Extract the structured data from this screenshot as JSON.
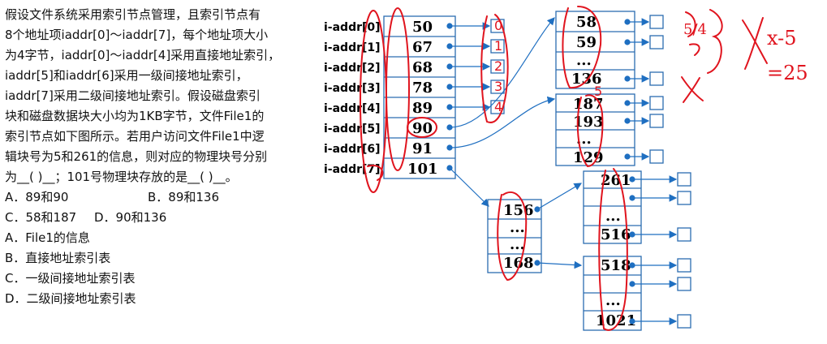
{
  "question": {
    "lines": [
      "假设文件系统采用索引节点管理，且索引节点有",
      "8个地址项iaddr[0]～iaddr[7]，每个地址项大小",
      "为4字节，iaddr[0]～iaddr[4]采用直接地址索引，",
      "iaddr[5]和iaddr[6]采用一级间接地址索引，",
      "iaddr[7]采用二级间接地址索引。假设磁盘索引",
      "块和磁盘数据块大小均为1KB字节，文件File1的",
      "索引节点如下图所示。若用户访问文件File1中逻",
      "辑块号为5和261的信息，则对应的物理块号分别",
      "为__( )__；101号物理块存放的是__( )__。"
    ],
    "options_row1": [
      {
        "label": "A．89和90",
        "right": "B．89和136"
      }
    ],
    "options_row2": [
      {
        "label": "C．58和187",
        "right": "D．90和136"
      }
    ],
    "options_single": [
      "A．File1的信息",
      "B．直接地址索引表",
      "C．一级间接地址索引表",
      "D．二级间接地址索引表"
    ]
  },
  "diagram": {
    "iaddr_labels": [
      "i-addr[0]",
      "i-addr[1]",
      "i-addr[2]",
      "i-addr[3]",
      "i-addr[4]",
      "i-addr[5]",
      "i-addr[6]",
      "i-addr[7]"
    ],
    "iaddr_values": [
      "50",
      "67",
      "68",
      "78",
      "89",
      "90",
      "91",
      "101"
    ],
    "block_a": [
      "58",
      "59",
      "...",
      "136"
    ],
    "block_b": [
      "187",
      "193",
      "...",
      "129"
    ],
    "block_c": [
      "156",
      "...",
      "...",
      "168"
    ],
    "block_d": [
      "261",
      "",
      "...",
      "516"
    ],
    "block_e": [
      "518",
      "",
      "...",
      "1021"
    ]
  },
  "annotations": {
    "handwritten_digits": [
      "0",
      "1",
      "2",
      "3",
      "4",
      "5"
    ],
    "right_notes": [
      "5/4",
      "x-5",
      "=25"
    ]
  },
  "colors": {
    "arrow": "#1f6fc1",
    "ink": "#e0141e",
    "border": "#2b6cb0"
  }
}
